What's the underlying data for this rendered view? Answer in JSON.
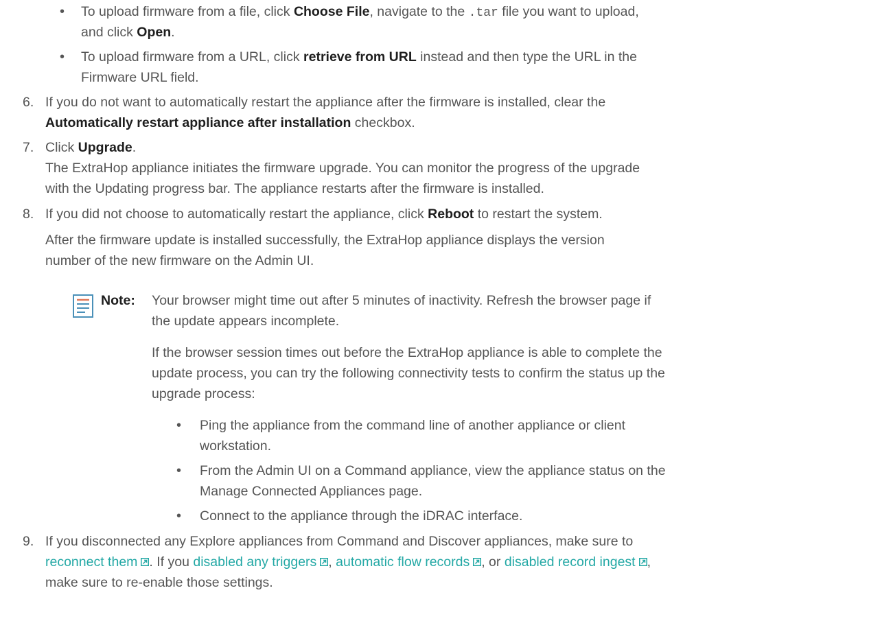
{
  "steps_top": {
    "bullet1": {
      "pre": "To upload firmware from a file, click ",
      "b1": "Choose File",
      "mid": ", navigate to the ",
      "code": ".tar",
      "post": " file you want to upload,",
      "line2_pre": "and click ",
      "b2": "Open",
      "line2_post": "."
    },
    "bullet2": {
      "pre": "To upload firmware from a URL, click ",
      "b1": "retrieve from URL",
      "post": " instead and then type the URL in the",
      "line2": "Firmware URL field."
    }
  },
  "step6": {
    "num": "6.",
    "line1": "If you do not want to automatically restart the appliance after the firmware is installed, clear the",
    "b1": "Automatically restart appliance after installation",
    "line2_post": " checkbox."
  },
  "step7": {
    "num": "7.",
    "pre": "Click ",
    "b1": "Upgrade",
    "post": ".",
    "p1": "The ExtraHop appliance initiates the firmware upgrade. You can monitor the progress of the upgrade",
    "p2": "with the Updating progress bar. The appliance restarts after the firmware is installed."
  },
  "step8": {
    "num": "8.",
    "pre": "If you did not choose to automatically restart the appliance, click ",
    "b1": "Reboot",
    "post": " to restart the system.",
    "p1": "After the firmware update is installed successfully, the ExtraHop appliance displays the version",
    "p2": "number of the new firmware on the Admin UI."
  },
  "note": {
    "label": "Note:",
    "l1": "Your browser might time out after 5 minutes of inactivity. Refresh the browser page if",
    "l2": "the update appears incomplete.",
    "p2_l1": "If the browser session times out before the ExtraHop appliance is able to complete the",
    "p2_l2": "update process, you can try the following connectivity tests to confirm the status up the",
    "p2_l3": "upgrade process:",
    "bullets": [
      {
        "l1": "Ping the appliance from the command line of another appliance or client",
        "l2": "workstation."
      },
      {
        "l1": "From the Admin UI on a Command appliance, view the appliance status on the",
        "l2": "Manage Connected Appliances page."
      },
      {
        "l1": "Connect to the appliance through the iDRAC interface.",
        "l2": ""
      }
    ]
  },
  "step9": {
    "num": "9.",
    "line1": "If you disconnected any Explore appliances from Command and Discover appliances, make sure to",
    "link1": "reconnect them",
    "mid1": ". If you ",
    "link2": "disabled any triggers",
    "sep1": ", ",
    "link3": "automatic flow records",
    "sep2": ", or ",
    "link4": "disabled record ingest",
    "sep3": ",",
    "line3": "make sure to re-enable those settings."
  },
  "colors": {
    "text": "#555555",
    "bold": "#1e1e1e",
    "link": "#23a8a5",
    "note_icon_accent": "#e0795a",
    "note_icon_lines": "#4a90b8"
  }
}
